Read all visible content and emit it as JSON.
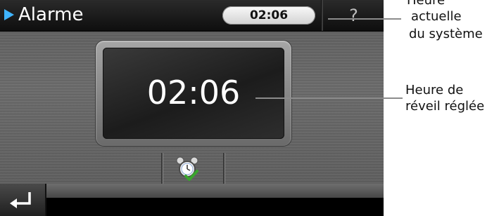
{
  "topbar": {
    "title": "Alarme",
    "current_time": "02:06",
    "help_label": "?"
  },
  "alarm": {
    "time": "02:06"
  },
  "annotations": {
    "current_time_label": [
      "Heure",
      "actuelle",
      "du système"
    ],
    "alarm_time_label": [
      "Heure de",
      "réveil réglée"
    ]
  },
  "icons": {
    "title": "play-arrow-icon",
    "alarm_button": "alarm-clock-check-icon",
    "back": "return-arrow-icon"
  },
  "colors": {
    "title_arrow": "#3fb4ff",
    "check": "#3aa52d"
  }
}
